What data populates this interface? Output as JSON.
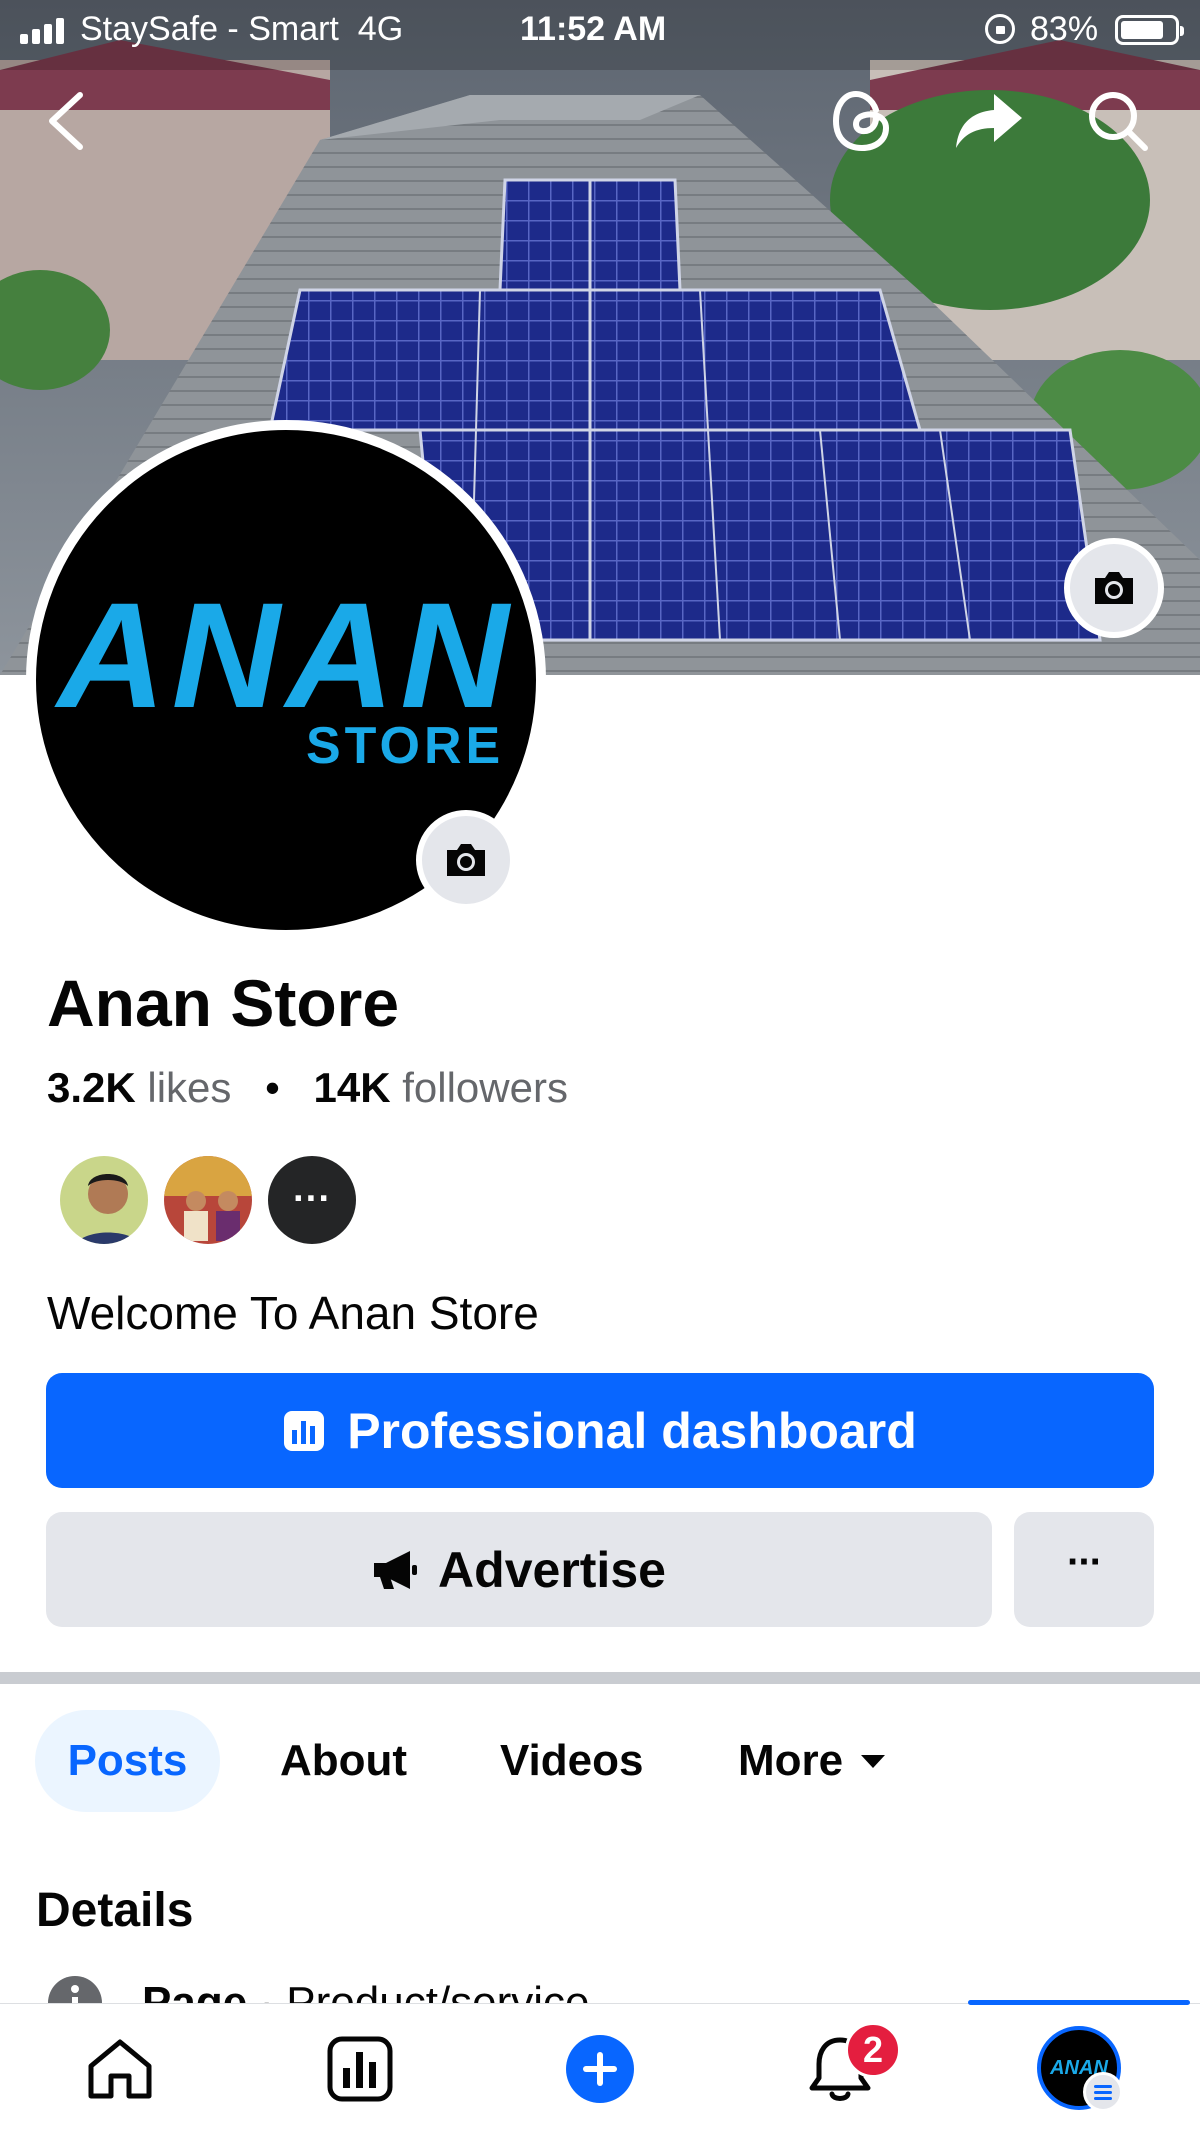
{
  "status_bar": {
    "carrier": "StaySafe - Smart",
    "network": "4G",
    "time": "11:52 AM",
    "battery": "83%",
    "battery_level": 0.83
  },
  "header": {
    "back_icon": "chevron-left-icon",
    "threads_icon": "threads-icon",
    "share_icon": "share-icon",
    "search_icon": "search-icon"
  },
  "profile": {
    "logo_main": "ANAN",
    "logo_sub": "STORE",
    "name": "Anan Store",
    "likes_count": "3.2K",
    "likes_label": "likes",
    "separator": "•",
    "followers_count": "14K",
    "followers_label": "followers",
    "more_friends_label": "···",
    "bio": "Welcome To Anan Store"
  },
  "actions": {
    "dashboard_label": "Professional dashboard",
    "advertise_label": "Advertise",
    "more_label": "···"
  },
  "tabs": [
    {
      "label": "Posts",
      "active": true
    },
    {
      "label": "About",
      "active": false
    },
    {
      "label": "Videos",
      "active": false
    },
    {
      "label": "More",
      "active": false
    }
  ],
  "details": {
    "title": "Details",
    "row_label": "Page",
    "row_value": "· Product/service"
  },
  "bottom_nav": {
    "items": [
      "home-icon",
      "dashboard-icon",
      "create-icon",
      "notifications-icon",
      "profile-avatar"
    ],
    "notification_badge": "2",
    "avatar_text": "ANAN"
  },
  "colors": {
    "accent": "#0866ff",
    "button_gray": "#e4e6eb",
    "logo_blue": "#1aa9e8",
    "badge_red": "#e41e3f"
  }
}
